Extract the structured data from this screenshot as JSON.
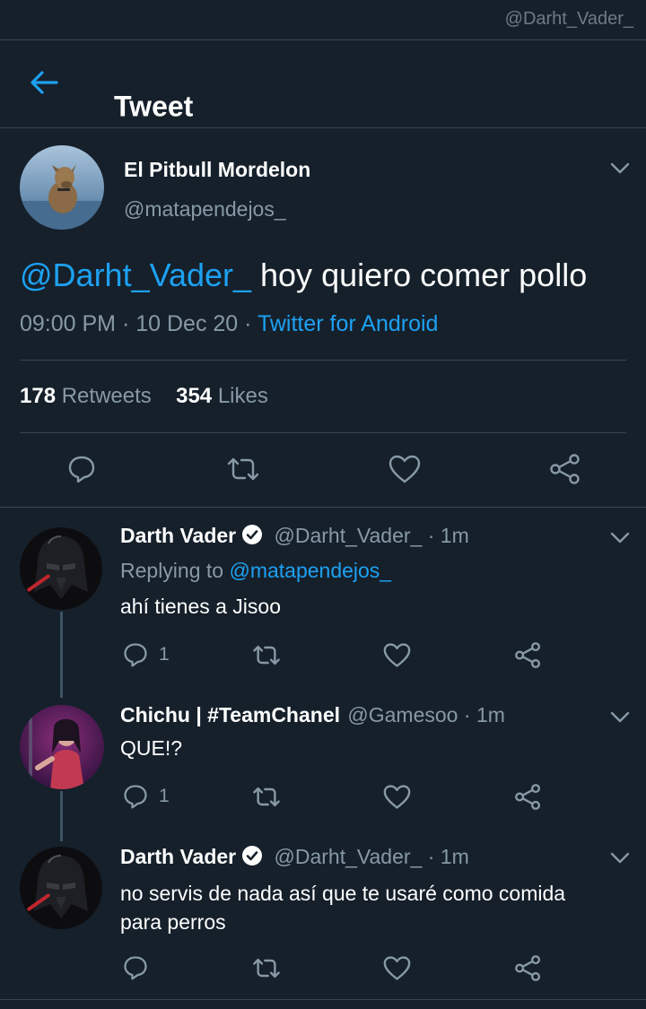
{
  "status_bar": {
    "handle": "@Darht_Vader_"
  },
  "header": {
    "title": "Tweet",
    "back_icon": "arrow-left-icon"
  },
  "main_tweet": {
    "author_name": "El Pitbull Mordelon",
    "author_handle": "@matapendejos_",
    "text_mention": "@Darht_Vader_",
    "text_body": " hoy quiero comer pollo",
    "time": "09:00 PM",
    "date": "10 Dec 20",
    "source": "Twitter for Android",
    "retweets_count": "178",
    "retweets_label": "Retweets",
    "likes_count": "354",
    "likes_label": "Likes"
  },
  "replies": [
    {
      "author_name": "Darth Vader",
      "verified": true,
      "handle": "@Darht_Vader_",
      "time": "1m",
      "replying_label": "Replying to ",
      "replying_to": "@matapendejos_",
      "text": "ahí tienes a Jisoo",
      "reply_count": "1"
    },
    {
      "author_name": "Chichu | #TeamChanel",
      "verified": false,
      "handle": "@Gamesoo",
      "time": "1m",
      "text": "QUE!?",
      "reply_count": "1"
    },
    {
      "author_name": "Darth Vader",
      "verified": true,
      "handle": "@Darht_Vader_",
      "time": "1m",
      "text_line1": "no servis de nada así que te usaré como comida",
      "text_line2": "para perros",
      "reply_count": ""
    }
  ],
  "colors": {
    "background": "#15202b",
    "accent": "#1da1f2",
    "muted": "#8899a6",
    "divider": "#38444d"
  }
}
